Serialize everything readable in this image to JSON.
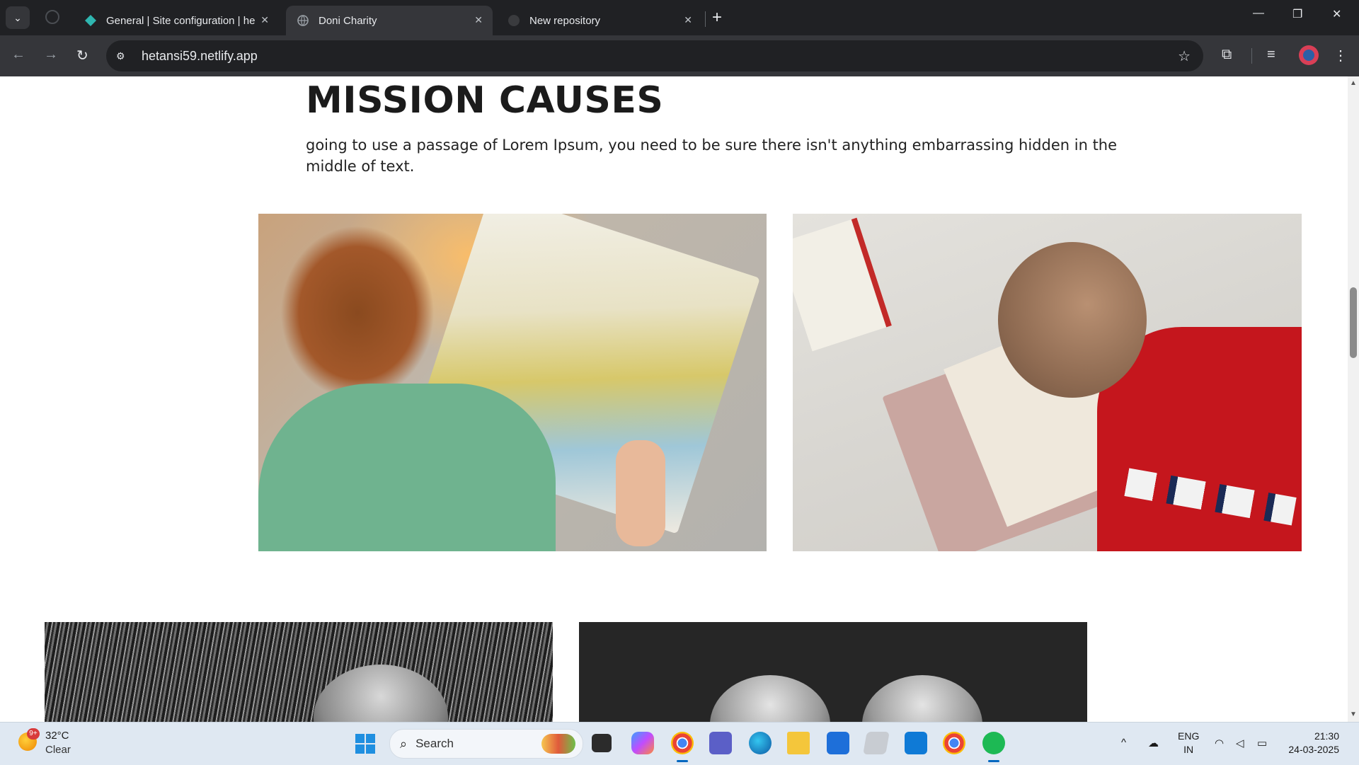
{
  "browser": {
    "tabs": [
      {
        "title": "General | Site configuration | he",
        "favicon": "netlify-diamond-icon",
        "active": false
      },
      {
        "title": "Doni Charity",
        "favicon": "globe-icon",
        "active": true
      },
      {
        "title": "New repository",
        "favicon": "github-icon",
        "active": false
      }
    ],
    "url": "hetansi59.netlify.app"
  },
  "page": {
    "heading": "MISSION CAUSES",
    "description": "going to use a passage of Lorem Ipsum, you need to be sure there isn't anything embarrassing hidden in the middle of text.",
    "photos": [
      "child-reading-map-photo",
      "baby-reading-book-photo",
      "grayscale-child-grass-photo",
      "grayscale-two-children-photo"
    ]
  },
  "taskbar": {
    "weather": {
      "temp": "32°C",
      "condition": "Clear",
      "badge": "9+"
    },
    "search_placeholder": "Search",
    "apps": [
      "file-explorer-app",
      "copilot-app",
      "chrome-app",
      "teams-app",
      "edge-app",
      "folder-app",
      "store-app",
      "notes-app",
      "vscode-app",
      "chrome-alt-app",
      "spotify-app"
    ],
    "language": {
      "line1": "ENG",
      "line2": "IN"
    },
    "clock": {
      "time": "21:30",
      "date": "24-03-2025"
    }
  },
  "colors": {
    "chrome_dark": "#202124",
    "chrome_toolbar": "#35363a",
    "taskbar": "#dfe8f2",
    "accent": "#0067c0"
  }
}
